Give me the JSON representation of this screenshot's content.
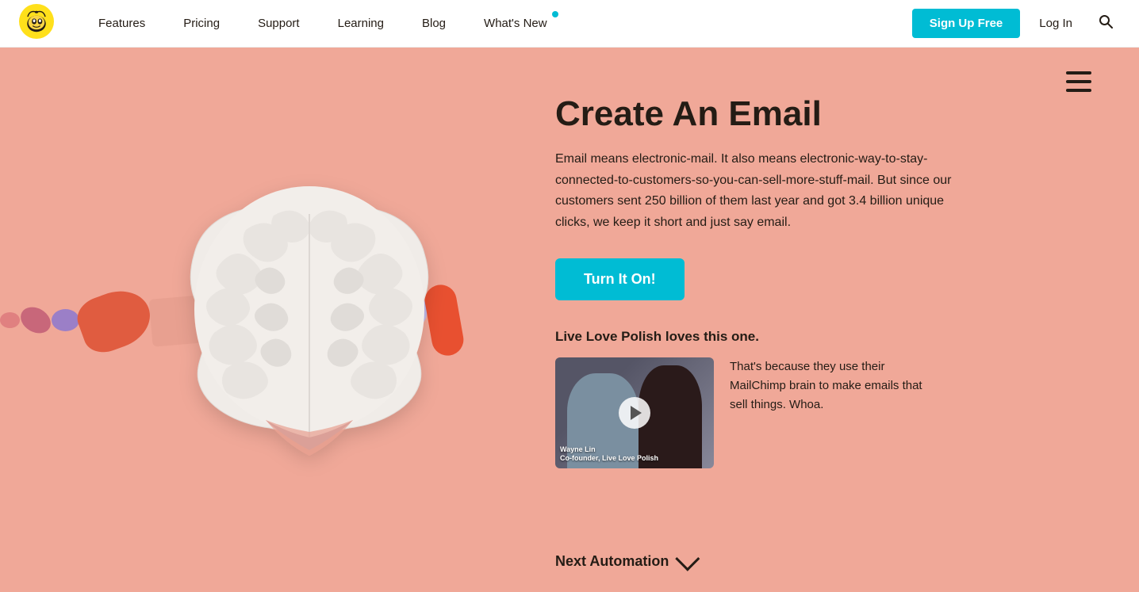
{
  "nav": {
    "logo_alt": "Mailchimp",
    "links": [
      {
        "id": "features",
        "label": "Features",
        "has_dot": false
      },
      {
        "id": "pricing",
        "label": "Pricing",
        "has_dot": false
      },
      {
        "id": "support",
        "label": "Support",
        "has_dot": false
      },
      {
        "id": "learning",
        "label": "Learning",
        "has_dot": false
      },
      {
        "id": "blog",
        "label": "Blog",
        "has_dot": false
      },
      {
        "id": "whats-new",
        "label": "What's New",
        "has_dot": true
      }
    ],
    "signup_label": "Sign Up Free",
    "login_label": "Log In"
  },
  "hero": {
    "title": "Create An Email",
    "description": "Email means electronic-mail. It also means electronic-way-to-stay-connected-to-customers-so-you-can-sell-more-stuff-mail. But since our customers sent 250 billion of them last year and got 3.4 billion unique clicks, we keep it short and just say email.",
    "cta_label": "Turn It On!",
    "testimonial_label": "Live Love Polish loves this one.",
    "testimonial_text": "That's because they use their MailChimp brain to make emails that sell things. Whoa.",
    "video_caption_name": "Wayne Lin",
    "video_caption_title": "Co-founder, Live Love Polish",
    "next_label": "Next Automation"
  }
}
